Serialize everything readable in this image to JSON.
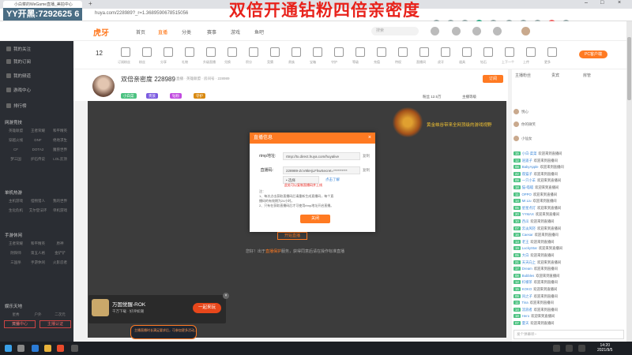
{
  "browser": {
    "tab_title": "小白菜的WeGame直播_美拍中心",
    "url": "huya.com/228989?_r=1.3689590678515056",
    "overlay_text": "YY开黑:7292625 6"
  },
  "banner": "双倍开通钻粉四倍亲密度",
  "site": {
    "logo": "虎牙",
    "nav": [
      "首页",
      "直播",
      "分类",
      "赛事",
      "游戏",
      "鱼吧"
    ],
    "search_placeholder": "搜索"
  },
  "giftbar": {
    "level": "12",
    "items": [
      "订阅粉丝",
      "粉丝",
      "分享",
      "礼物",
      "升级直播",
      "兑换",
      "积分",
      "竞猜",
      "贵族",
      "宝箱",
      "守护",
      "等级",
      "充值",
      "特权",
      "直播间",
      "虎牙",
      "道具",
      "钻石",
      "上下一个",
      "上传",
      "更多"
    ],
    "pc_button": "PC客户端"
  },
  "room": {
    "title": "双倍亲密度 228989",
    "meta": "直播 · 英雄联盟 · 房间号 · 228989",
    "badges": [
      {
        "text": "小白菜",
        "color": "#4cc281"
      },
      {
        "text": "贵族",
        "color": "#7b5be0"
      },
      {
        "text": "钻粉",
        "color": "#c24be0"
      },
      {
        "text": "守护",
        "color": "#d98a12"
      }
    ],
    "stats": [
      "粉丝 12.5万",
      "主播等级"
    ],
    "follow_label": "订阅"
  },
  "sidebar": {
    "items": [
      "我的关注",
      "我的订阅",
      "我的频道",
      "游戏中心",
      "排行榜"
    ],
    "sections": [
      "网游竞技",
      "单机热游",
      "手游休闲",
      "娱乐天地"
    ],
    "grids": [
      [
        "英雄联盟",
        "王者荣耀",
        "和平精英",
        "穿越火线",
        "DNF",
        "绝地求生",
        "CF",
        "DOTA2",
        "魔兽世界",
        "梦三国",
        "炉石传说",
        "LOL云顶"
      ],
      [
        "主机游戏",
        "怪物猎人",
        "我的世界",
        "生化危机",
        "艾尔登法环",
        "单机游戏"
      ],
      [
        "王者荣耀",
        "和平精英",
        "原神",
        "阴阳师",
        "第五人格",
        "金铲铲",
        "三国杀",
        "手游休闲",
        "火影忍者"
      ],
      [
        "星秀",
        "户外",
        "二次元",
        "美食"
      ]
    ],
    "bottom_buttons": [
      "开播中心",
      "主播认证"
    ]
  },
  "modal": {
    "title": "直播信息",
    "close": "×",
    "rtmp_label": "rtmp地址:",
    "rtmp_value": "rtmp://tx.direct.huya.com/huyalive",
    "copy1": "复制",
    "key_label": "直播码:",
    "key_value": "228989-ZcV8kHjLFhwSecret=**********",
    "copy2": "复制",
    "option_value": "• 选择",
    "option_link": "点击了解",
    "warn": "此处可以复制直播码并上线",
    "notes": [
      "注：",
      "1、每次点击获取直播码后请重新生成直播码，每个直",
      "播码的有效期为24小时。",
      "2、只有在获取直播码后才可使用rtmp地址开启直播。"
    ],
    "ok": "关闭"
  },
  "video": {
    "crest_text": "黄金峡谷带来全网顶级的游戏视野",
    "tip_prefix": "您好！出于",
    "tip_highlight": "直播保护",
    "tip_suffix": "服务，获得同意后请在操作标准直播",
    "ghost_button": "开始直播"
  },
  "promo": {
    "title": "万国觉醒-ROK",
    "sub": "千万下载 · 好评如潮",
    "button": "一起来玩",
    "close": "×",
    "toast": "主播直播时长满足要求后，可参加更多活动，亦可参与更多直播活动"
  },
  "chat": {
    "tabs": [
      "主播粉丝",
      "贵宾",
      "房管"
    ],
    "ranks": [
      {
        "name": "悦心"
      },
      {
        "name": "你的微笑"
      },
      {
        "name": "小仙女"
      }
    ],
    "messages": [
      {
        "lv": "15",
        "nick": "小白·菜菜",
        "text": "欢迎来到直播间"
      },
      {
        "lv": "12",
        "nick": "逍遥子",
        "text": "欢迎来到直播间"
      },
      {
        "lv": "08",
        "nick": "BabyApple",
        "text": "欢迎来到直播间"
      },
      {
        "lv": "22",
        "nick": "夜猫子",
        "text": "欢迎来到直播间"
      },
      {
        "lv": "09",
        "nick": "一只小羊",
        "text": "欢迎来到直播间"
      },
      {
        "lv": "18",
        "nick": "猫-喵喵",
        "text": "欢迎来到直播间"
      },
      {
        "lv": "11",
        "nick": "OPPO",
        "text": "欢迎来到直播间"
      },
      {
        "lv": "14",
        "nick": "Mr.Liu",
        "text": "欢迎来到直播间"
      },
      {
        "lv": "06",
        "nick": "星星点灯",
        "text": "欢迎来到直播间"
      },
      {
        "lv": "20",
        "nick": "YYMAX",
        "text": "欢迎来到直播间"
      },
      {
        "lv": "10",
        "nick": "西瓜",
        "text": "欢迎来到直播间"
      },
      {
        "lv": "07",
        "nick": "云淡风轻",
        "text": "欢迎来到直播间"
      },
      {
        "lv": "16",
        "nick": "Caesar",
        "text": "欢迎来到直播间"
      },
      {
        "lv": "13",
        "nick": "老王",
        "text": "欢迎来到直播间"
      },
      {
        "lv": "19",
        "nick": "LuckyStar",
        "text": "欢迎来到直播间"
      },
      {
        "lv": "05",
        "nick": "大白",
        "text": "欢迎来到直播间"
      },
      {
        "lv": "21",
        "nick": "天天向上",
        "text": "欢迎来到直播间"
      },
      {
        "lv": "17",
        "nick": "Dream",
        "text": "欢迎来到直播间"
      },
      {
        "lv": "08",
        "nick": "Bubbles",
        "text": "欢迎来到直播间"
      },
      {
        "lv": "12",
        "nick": "柠檬茶",
        "text": "欢迎来到直播间"
      },
      {
        "lv": "15",
        "nick": "KOKO",
        "text": "欢迎来到直播间"
      },
      {
        "lv": "09",
        "nick": "风之子",
        "text": "欢迎来到直播间"
      },
      {
        "lv": "11",
        "nick": "Tina",
        "text": "欢迎来到直播间"
      },
      {
        "lv": "14",
        "nick": "流浪者",
        "text": "欢迎来到直播间"
      },
      {
        "lv": "18",
        "nick": "Hero",
        "text": "欢迎来到直播间"
      },
      {
        "lv": "07",
        "nick": "夏天",
        "text": "欢迎来到直播间"
      }
    ],
    "input_placeholder": "发个弹幕呗~"
  },
  "taskbar": {
    "time": "14:20",
    "date": "2021/9/5"
  },
  "colors": {
    "accent": "#ff7a22",
    "banner": "#e8221b",
    "sidebar": "#2a2d33"
  }
}
